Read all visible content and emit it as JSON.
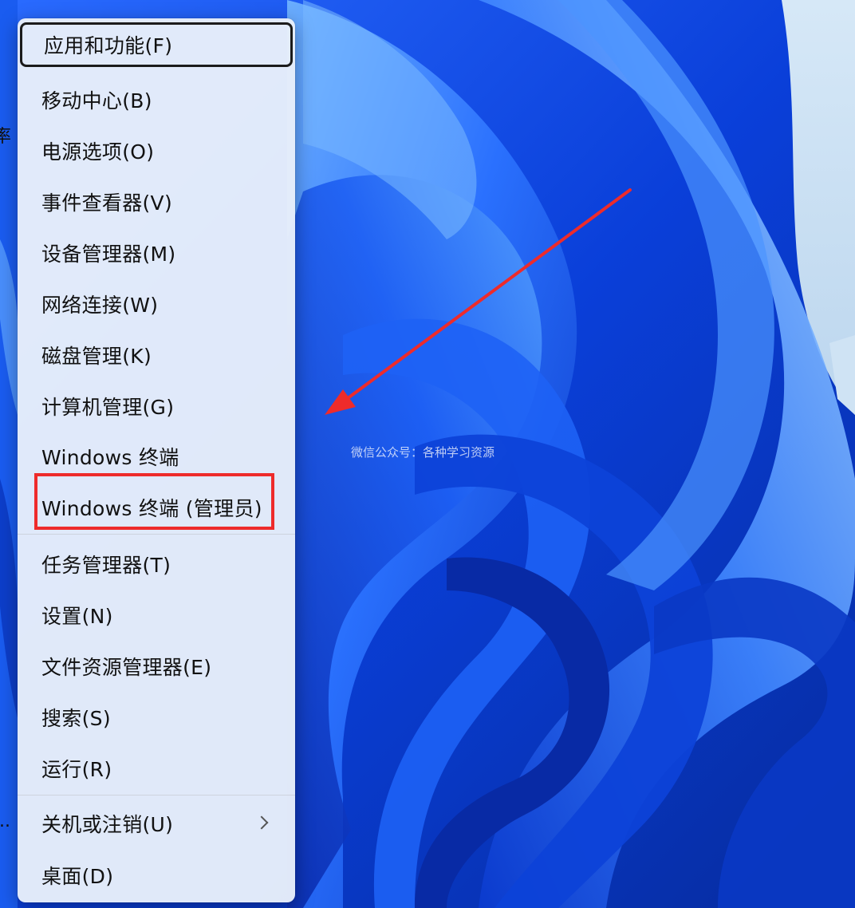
{
  "wallpaper": {
    "left_edge_texts": [
      "率",
      "·",
      "·",
      "·",
      "..."
    ]
  },
  "menu": {
    "items": [
      {
        "label": "应用和功能(F)"
      },
      {
        "label": "移动中心(B)"
      },
      {
        "label": "电源选项(O)"
      },
      {
        "label": "事件查看器(V)"
      },
      {
        "label": "设备管理器(M)"
      },
      {
        "label": "网络连接(W)"
      },
      {
        "label": "磁盘管理(K)"
      },
      {
        "label": "计算机管理(G)"
      },
      {
        "label": "Windows 终端"
      },
      {
        "label": "Windows 终端 (管理员)"
      },
      {
        "label": "任务管理器(T)"
      },
      {
        "label": "设置(N)"
      },
      {
        "label": "文件资源管理器(E)"
      },
      {
        "label": "搜索(S)"
      },
      {
        "label": "运行(R)"
      },
      {
        "label": "关机或注销(U)"
      },
      {
        "label": "桌面(D)"
      }
    ]
  },
  "watermark": "微信公众号：各种学习资源",
  "colors": {
    "highlight": "#ee2b2b",
    "arrow": "#ee2b2b",
    "menu_background": "#e7eefa",
    "wallpaper_blue": "#1552e6"
  }
}
